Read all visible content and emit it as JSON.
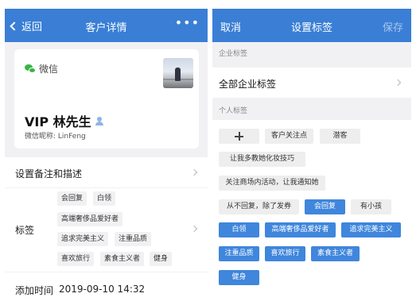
{
  "left": {
    "nav": {
      "back": "返回",
      "title": "客户详情",
      "more": "•••"
    },
    "card": {
      "source": "微信",
      "name": "VIP 林先生",
      "nickname": "微信昵称: LinFeng"
    },
    "remark_row": {
      "label": "设置备注和描述"
    },
    "tags_row": {
      "label": "标签",
      "tags": [
        "会回复",
        "白领",
        "高端奢侈品爱好者",
        "追求完美主义",
        "注重品质",
        "喜欢旅行",
        "素食主义者",
        "健身"
      ]
    },
    "added_row": {
      "label": "添加时间",
      "value": "2019-09-10 14:32"
    }
  },
  "right": {
    "nav": {
      "cancel": "取消",
      "title": "设置标签",
      "save": "保存"
    },
    "enterprise_header": "企业标签",
    "all_enterprise_tags": "全部企业标签",
    "personal_header": "个人标签",
    "add_button": "+",
    "tags": [
      {
        "label": "客户关注点",
        "selected": false
      },
      {
        "label": "潜客",
        "selected": false
      },
      {
        "label": "让我多教她化妆技巧",
        "selected": false
      },
      {
        "label": "关注商场内活动，让我通知她",
        "selected": false
      },
      {
        "label": "从不回复，除了发券",
        "selected": false
      },
      {
        "label": "会回复",
        "selected": true
      },
      {
        "label": "有小孩",
        "selected": false
      },
      {
        "label": "白领",
        "selected": true
      },
      {
        "label": "高端奢侈品爱好者",
        "selected": true
      },
      {
        "label": "追求完美主义",
        "selected": true
      },
      {
        "label": "注重品质",
        "selected": true
      },
      {
        "label": "喜欢旅行",
        "selected": true
      },
      {
        "label": "素食主义者",
        "selected": true
      },
      {
        "label": "健身",
        "selected": true
      }
    ]
  },
  "colors": {
    "nav_blue": "#3a7fd5",
    "selected_tag": "#3f86dc",
    "wechat_green": "#39b54a"
  }
}
